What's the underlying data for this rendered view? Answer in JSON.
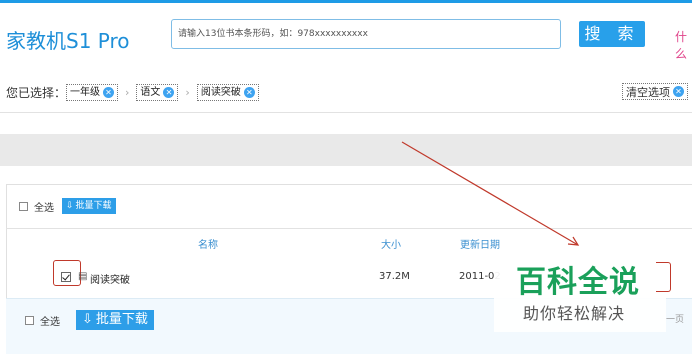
{
  "header": {
    "brand": "家教机S1 Pro",
    "search_placeholder": "请输入13位书本条形码，如：978xxxxxxxxxx",
    "search_button": "搜 索",
    "right_link": "什么"
  },
  "filters": {
    "label": "您已选择：",
    "tags": [
      "一年级",
      "语文",
      "阅读突破"
    ],
    "clear": "清空选项"
  },
  "toolbar": {
    "select_all": "全选",
    "batch_download": "批量下载"
  },
  "table": {
    "columns": [
      "名称",
      "大小",
      "更新日期"
    ],
    "rows": [
      {
        "name": "阅读突破",
        "size": "37.2M",
        "date": "2011-02",
        "checked": true
      }
    ]
  },
  "footer": {
    "select_all": "全选",
    "batch_download": "批量下载",
    "pager": "一页"
  },
  "watermark": {
    "title": "百科全说",
    "subtitle": "助你轻松解决"
  },
  "colors": {
    "accent": "#28a0ea",
    "annotation": "#c0392b",
    "watermark_green": "#1aa05a"
  }
}
